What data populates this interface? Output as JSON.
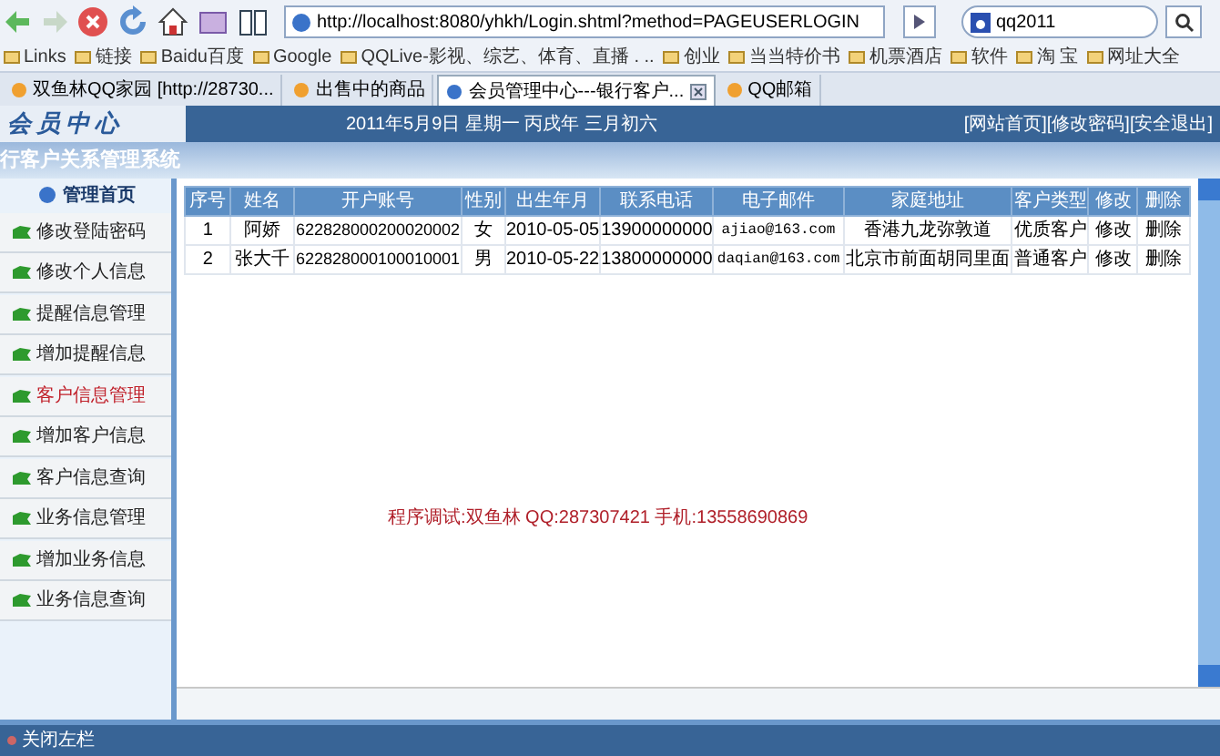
{
  "browser": {
    "address": "http://localhost:8080/yhkh/Login.shtml?method=PAGEUSERLOGIN",
    "search": "qq2011",
    "bookmarks": [
      "Links",
      "链接",
      "Baidu百度",
      "Google",
      "QQLive-影视、综艺、体育、直播 . ..",
      "创业",
      "当当特价书",
      "机票酒店",
      "软件",
      "淘 宝",
      "网址大全"
    ],
    "tabs": [
      {
        "label": "双鱼林QQ家园 [http://28730...",
        "selected": false
      },
      {
        "label": "出售中的商品",
        "selected": false
      },
      {
        "label": "会员管理中心---银行客户...",
        "selected": true
      },
      {
        "label": "QQ邮箱",
        "selected": false
      }
    ]
  },
  "header": {
    "logo": "会员中心",
    "date": "2011年5月9日 星期一 丙戌年 三月初六",
    "links": [
      "[网站首页]",
      "[修改密码]",
      "[安全退出]"
    ],
    "system_title": "行客户关系管理系统"
  },
  "sidebar": {
    "title": "管理首页",
    "items": [
      {
        "label": "修改登陆密码",
        "selected": false
      },
      {
        "label": "修改个人信息",
        "selected": false
      },
      {
        "label": "提醒信息管理",
        "selected": false
      },
      {
        "label": "增加提醒信息",
        "selected": false
      },
      {
        "label": "客户信息管理",
        "selected": true
      },
      {
        "label": "增加客户信息",
        "selected": false
      },
      {
        "label": "客户信息查询",
        "selected": false
      },
      {
        "label": "业务信息管理",
        "selected": false
      },
      {
        "label": "增加业务信息",
        "selected": false
      },
      {
        "label": "业务信息查询",
        "selected": false
      }
    ],
    "footer": "关闭左栏"
  },
  "table": {
    "columns": [
      "序号",
      "姓名",
      "开户账号",
      "性别",
      "出生年月",
      "联系电话",
      "电子邮件",
      "家庭地址",
      "客户类型",
      "修改",
      "删除"
    ],
    "rows": [
      [
        "1",
        "阿娇",
        "622828000200020002",
        "女",
        "2010-05-05",
        "13900000000",
        "ajiao@163.com",
        "香港九龙弥敦道",
        "优质客户",
        "修改",
        "删除"
      ],
      [
        "2",
        "张大千",
        "622828000100010001",
        "男",
        "2010-05-22",
        "13800000000",
        "daqian@163.com",
        "北京市前面胡同里面",
        "普通客户",
        "修改",
        "删除"
      ]
    ]
  },
  "credit": "程序调试:双鱼林 QQ:287307421 手机:13558690869"
}
